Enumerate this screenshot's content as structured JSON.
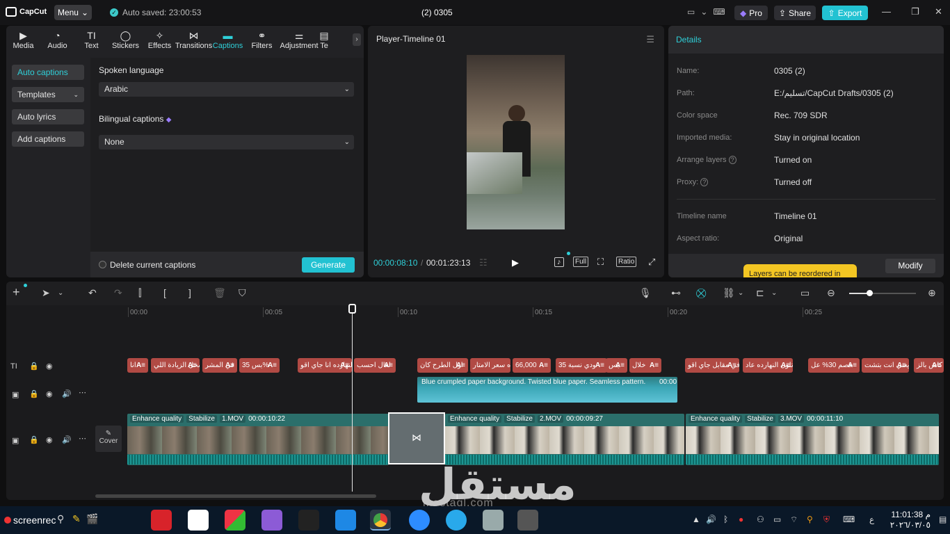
{
  "app": {
    "brand": "CapCut",
    "menu_label": "Menu",
    "autosave": "Auto saved: 23:00:53",
    "project_title": "(2) 0305",
    "pro_label": "Pro",
    "share_label": "Share",
    "export_label": "Export",
    "accent": "#22c2d2"
  },
  "toolbar": {
    "tools": [
      {
        "label": "Media",
        "icon": "media-icon"
      },
      {
        "label": "Audio",
        "icon": "audio-icon"
      },
      {
        "label": "Text",
        "icon": "text-icon"
      },
      {
        "label": "Stickers",
        "icon": "stickers-icon"
      },
      {
        "label": "Effects",
        "icon": "effects-icon"
      },
      {
        "label": "Transitions",
        "icon": "transitions-icon"
      },
      {
        "label": "Captions",
        "icon": "captions-icon",
        "active": true
      },
      {
        "label": "Filters",
        "icon": "filters-icon"
      },
      {
        "label": "Adjustment",
        "icon": "adjustment-icon"
      },
      {
        "label": "Te",
        "icon": "templates-icon"
      }
    ]
  },
  "captions_panel": {
    "sidebar": [
      {
        "label": "Auto captions",
        "active": true
      },
      {
        "label": "Templates"
      },
      {
        "label": "Auto lyrics"
      },
      {
        "label": "Add captions"
      }
    ],
    "spoken_language_label": "Spoken language",
    "spoken_language_value": "Arabic",
    "bilingual_label": "Bilingual captions",
    "bilingual_value": "None",
    "delete_label": "Delete current captions",
    "generate_label": "Generate"
  },
  "player": {
    "title": "Player-Timeline 01",
    "current_time": "00:00:08:10",
    "total_time": "00:01:23:13",
    "full_label": "Full",
    "ratio_label": "Ratio"
  },
  "details": {
    "title": "Details",
    "rows": [
      {
        "key": "Name:",
        "value": "0305 (2)"
      },
      {
        "key": "Path:",
        "value": "E:/تسليم/CapCut Drafts/0305 (2)"
      },
      {
        "key": "Color space",
        "value": "Rec. 709 SDR"
      },
      {
        "key": "Imported media:",
        "value": "Stay in original location"
      },
      {
        "key": "Arrange layers",
        "value": "Turned on"
      },
      {
        "key": "Proxy:",
        "value": "Turned off"
      },
      {
        "key": "Timeline name",
        "value": "Timeline 01"
      },
      {
        "key": "Aspect ratio:",
        "value": "Original"
      }
    ],
    "tooltip": "Layers can be reordered in",
    "modify_label": "Modify"
  },
  "timeline": {
    "ruler": [
      "00:00",
      "00:05",
      "00:10",
      "00:15",
      "00:20",
      "00:25"
    ],
    "zoom_level": 0.3,
    "caption_chips": [
      {
        "text": "انا"
      },
      {
        "text": "محل الزيادة اللي"
      },
      {
        "text": "في المشر"
      },
      {
        "text": "بس 35%"
      },
      {
        "text": "النهارده انا جاي اقو"
      },
      {
        "text": "لعال احسب"
      },
      {
        "text": "اول الطرح كان"
      },
      {
        "text": "النهارده سعر الامتار"
      },
      {
        "text": "66,000"
      },
      {
        "text": "ودي نسبة 35"
      },
      {
        "text": "بس"
      },
      {
        "text": "خلال"
      },
      {
        "text": "في مقابل جاي اقو"
      },
      {
        "text": "تلون النهارده عاد"
      },
      {
        "text": "خصم 30% عل"
      },
      {
        "text": "يعني انت بتشت"
      },
      {
        "text": "كاش بالز"
      }
    ],
    "overlay_clip": "Blue crumpled paper background. Twisted blue paper. Seamless pattern.",
    "overlay_time": "00:00",
    "clips": [
      {
        "tags": [
          "Enhance quality",
          "Stabilize",
          "1.MOV"
        ],
        "duration": "00:00:10:22"
      },
      {
        "tags": [
          "Enhance quality",
          "Stabilize",
          "2.MOV"
        ],
        "duration": "00:00:09:27"
      },
      {
        "tags": [
          "Enhance quality",
          "Stabilize",
          "3.MOV"
        ],
        "duration": "00:00:11:10"
      }
    ],
    "cover_label": "Cover"
  },
  "watermark": {
    "arabic": "مستقل",
    "latin": "mostaql.com"
  },
  "taskbar": {
    "screenrec": "screenrec",
    "lang": "ع",
    "time": "11:01:38 م",
    "date": "٢٠٢٦/٠٣/٠٥"
  }
}
